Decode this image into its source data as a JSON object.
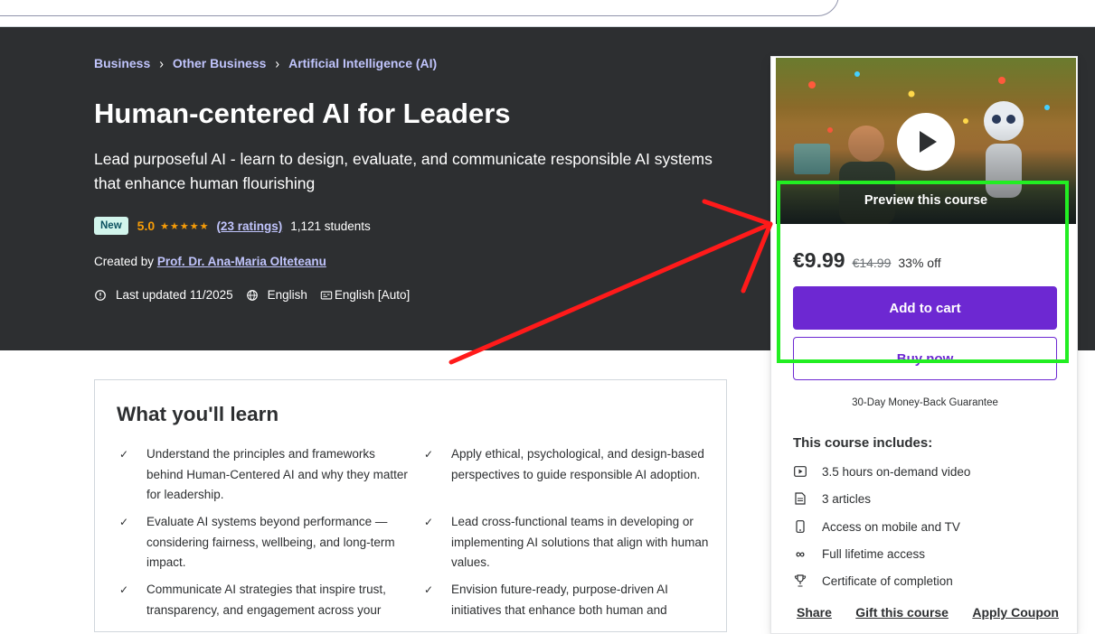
{
  "breadcrumb": [
    "Business",
    "Other Business",
    "Artificial Intelligence (AI)"
  ],
  "course": {
    "title": "Human-centered AI for Leaders",
    "subtitle": "Lead purposeful AI - learn to design, evaluate, and communicate responsible AI systems that enhance human flourishing",
    "badge": "New",
    "rating": "5.0",
    "stars": "★★★★★",
    "ratings_link": "(23 ratings)",
    "students": "1,121 students",
    "created_by_label": "Created by",
    "instructor": "Prof. Dr. Ana-Maria Olteteanu",
    "last_updated": "Last updated 11/2025",
    "language": "English",
    "captions": "English [Auto]"
  },
  "learn": {
    "title": "What you'll learn",
    "items": [
      "Understand the principles and frameworks behind Human-Centered AI and why they matter for leadership.",
      "Apply ethical, psychological, and design-based perspectives to guide responsible AI adoption.",
      "Evaluate AI systems beyond performance — considering fairness, wellbeing, and long-term impact.",
      "Lead cross-functional teams in developing or implementing AI solutions that align with human values.",
      "Communicate AI strategies that inspire trust, transparency, and engagement across your",
      "Envision future-ready, purpose-driven AI initiatives that enhance both human and"
    ]
  },
  "sidebar": {
    "preview_label": "Preview this course",
    "price": "€9.99",
    "original_price": "€14.99",
    "discount": "33% off",
    "add_to_cart": "Add to cart",
    "buy_now": "Buy now",
    "guarantee": "30-Day Money-Back Guarantee",
    "includes_title": "This course includes:",
    "includes": [
      {
        "icon": "video-icon",
        "text": "3.5 hours on-demand video"
      },
      {
        "icon": "article-icon",
        "text": "3 articles"
      },
      {
        "icon": "mobile-icon",
        "text": "Access on mobile and TV"
      },
      {
        "icon": "infinity-icon",
        "text": "Full lifetime access"
      },
      {
        "icon": "trophy-icon",
        "text": "Certificate of completion"
      }
    ],
    "links": [
      "Share",
      "Gift this course",
      "Apply Coupon"
    ]
  },
  "colors": {
    "hero_bg": "#2d2f31",
    "accent": "#6d28d2",
    "link": "#c0c4fc",
    "star": "#f69c08",
    "highlight": "#22ee22",
    "arrow": "#ff1a1a"
  }
}
